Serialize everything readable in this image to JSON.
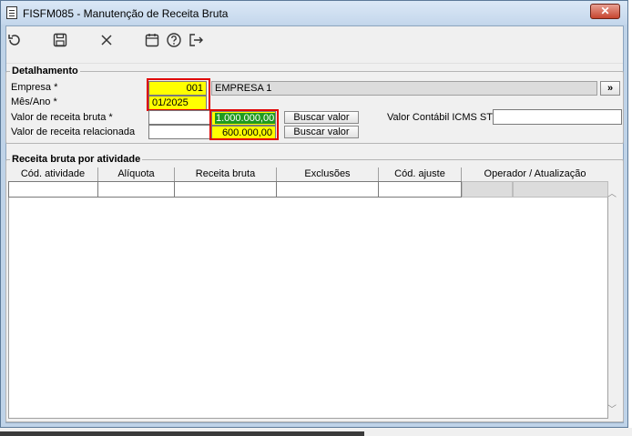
{
  "window": {
    "title": "FISFM085 - Manutenção de Receita Bruta",
    "close_label": "✕"
  },
  "toolbar": {
    "icons": [
      "refresh-icon",
      "save-icon",
      "close-icon",
      "calendar-icon",
      "help-icon",
      "exit-icon"
    ]
  },
  "detalhamento": {
    "legend": "Detalhamento",
    "empresa_label": "Empresa *",
    "empresa_code": "001",
    "empresa_name": "EMPRESA 1",
    "lookup_label": "»",
    "mes_ano_label": "Mês/Ano *",
    "mes_ano_value": "01/2025",
    "valor_receita_bruta_label": "Valor de receita bruta *",
    "valor_receita_bruta_value": "1.000.000,00",
    "valor_receita_relacionada_label": "Valor de receita relacionada",
    "valor_receita_relacionada_value": "600.000,00",
    "buscar_valor_label": "Buscar valor",
    "valor_contabil_label": "Valor Contábil ICMS ST",
    "valor_contabil_value": ""
  },
  "receita_por_atividade": {
    "legend": "Receita bruta por atividade",
    "columns": [
      "Cód. atividade",
      "Alíquota",
      "Receita bruta",
      "Exclusões",
      "Cód. ajuste",
      "Operador / Atualização"
    ]
  },
  "colors": {
    "highlight": "#ffff00",
    "marker": "#e00000",
    "selection": "#1f9a1f"
  }
}
